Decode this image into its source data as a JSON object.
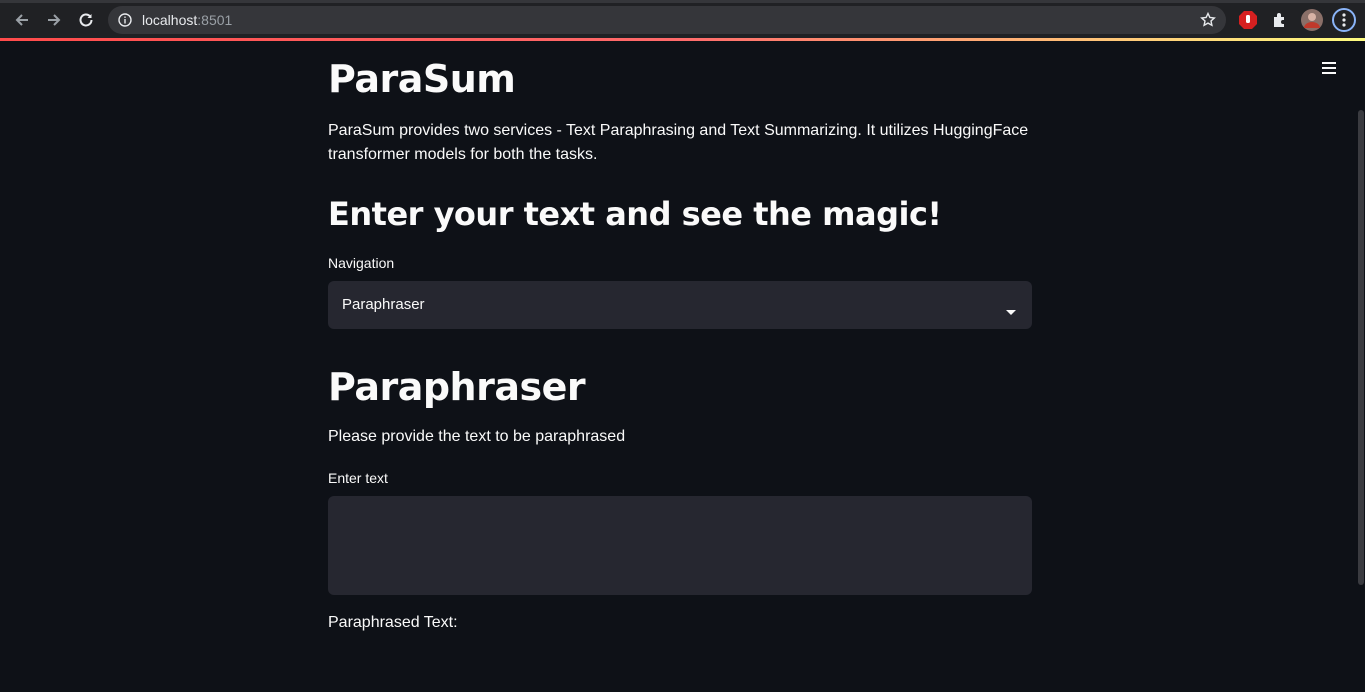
{
  "browser": {
    "url_host": "localhost",
    "url_port": ":8501",
    "icons": [
      "back-arrow-icon",
      "forward-arrow-icon",
      "reload-icon",
      "site-info-icon",
      "bookmark-star-icon",
      "adblock-extension-icon",
      "extensions-puzzle-icon",
      "profile-avatar",
      "chrome-menu-icon"
    ]
  },
  "app": {
    "title": "ParaSum",
    "description": "ParaSum provides two services - Text Paraphrasing and Text Summarizing. It utilizes HuggingFace transformer models for both the tasks.",
    "subtitle": "Enter your text and see the magic!",
    "navigation": {
      "label": "Navigation",
      "selected": "Paraphraser"
    },
    "section": {
      "title": "Paraphraser",
      "hint": "Please provide the text to be paraphrased",
      "input_label": "Enter text",
      "input_value": "",
      "output_label": "Paraphrased Text:"
    }
  },
  "colors": {
    "background": "#0e1117",
    "widget": "#262730",
    "accent": "#ff4b4b",
    "text": "#fafafa"
  }
}
